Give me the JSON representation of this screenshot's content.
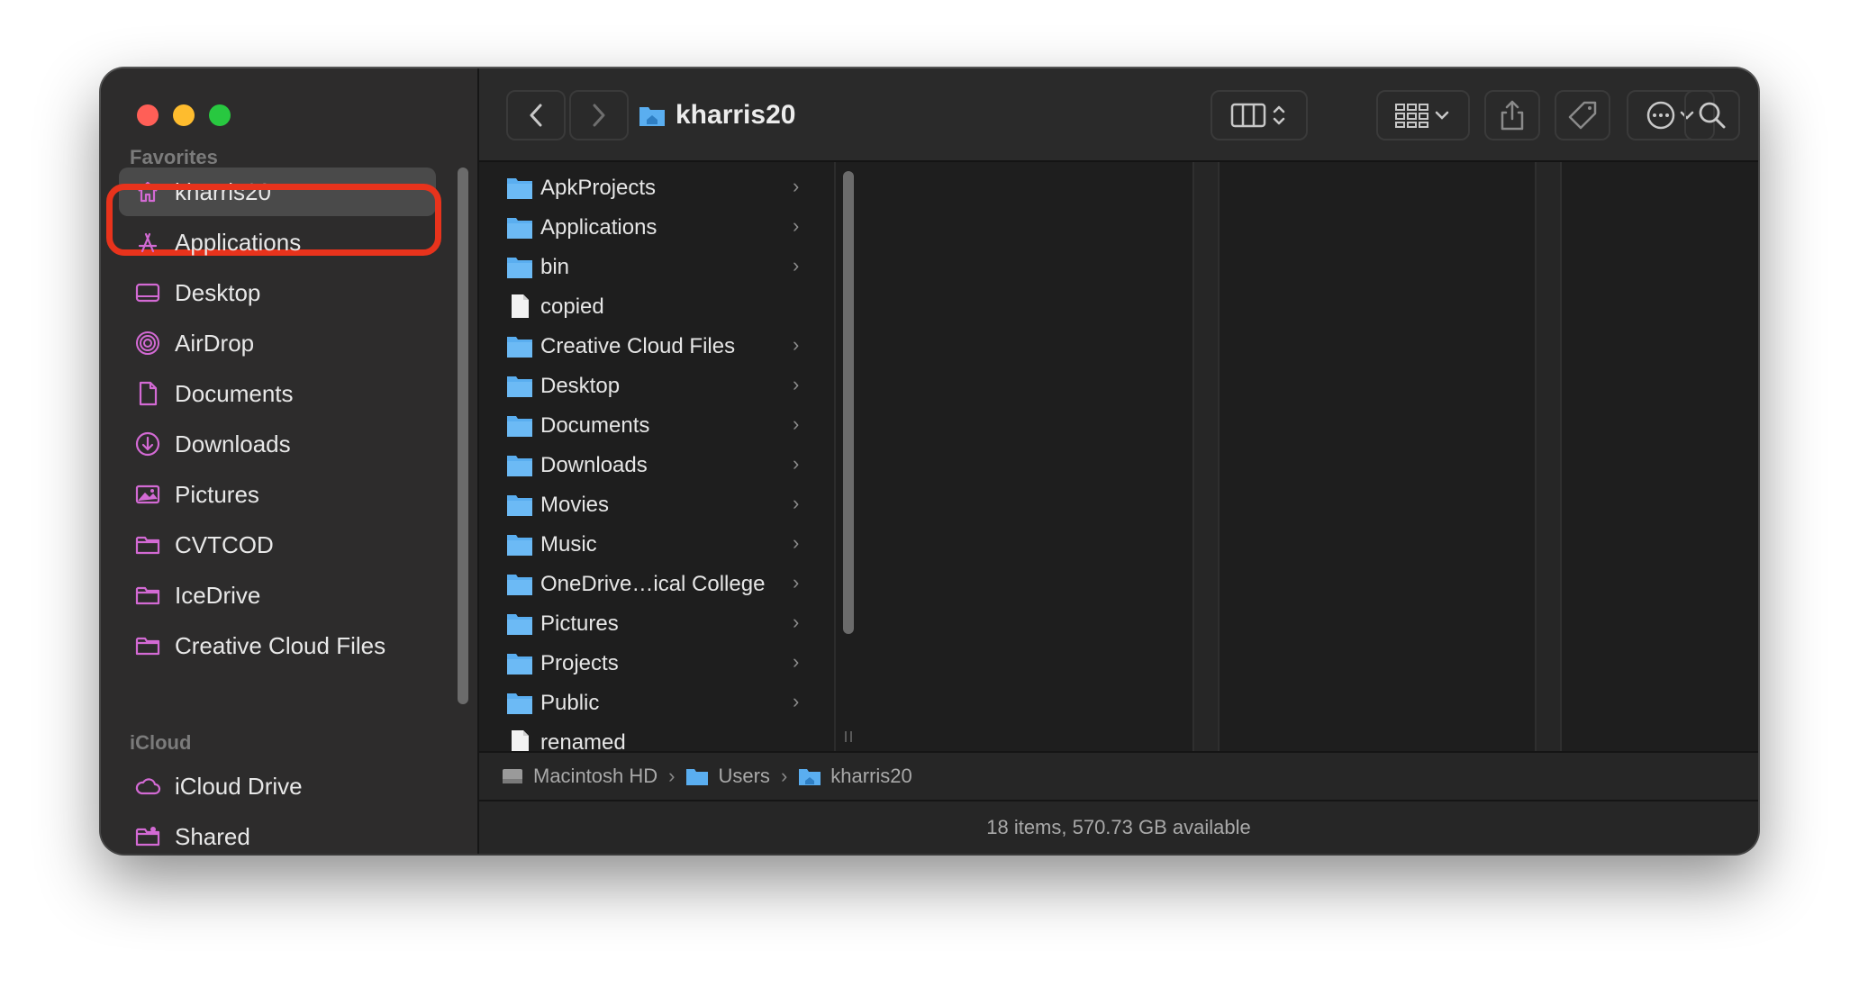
{
  "window": {
    "title": "kharris20"
  },
  "sidebar": {
    "favorites_label": "Favorites",
    "favorites": [
      {
        "label": "kharris20",
        "icon": "home-icon",
        "selected": true
      },
      {
        "label": "Applications",
        "icon": "applications-icon"
      },
      {
        "label": "Desktop",
        "icon": "desktop-icon"
      },
      {
        "label": "AirDrop",
        "icon": "airdrop-icon"
      },
      {
        "label": "Documents",
        "icon": "document-icon"
      },
      {
        "label": "Downloads",
        "icon": "download-icon"
      },
      {
        "label": "Pictures",
        "icon": "pictures-icon"
      },
      {
        "label": "CVTCOD",
        "icon": "folder-icon"
      },
      {
        "label": "IceDrive",
        "icon": "folder-icon"
      },
      {
        "label": "Creative Cloud Files",
        "icon": "folder-icon"
      }
    ],
    "icloud_label": "iCloud",
    "icloud": [
      {
        "label": "iCloud Drive",
        "icon": "cloud-icon"
      },
      {
        "label": "Shared",
        "icon": "shared-folder-icon"
      }
    ],
    "icon_color": "#d36ad4"
  },
  "files": [
    {
      "name": "ApkProjects",
      "type": "folder"
    },
    {
      "name": "Applications",
      "type": "folder"
    },
    {
      "name": "bin",
      "type": "folder"
    },
    {
      "name": "copied",
      "type": "file"
    },
    {
      "name": "Creative Cloud Files",
      "type": "folder"
    },
    {
      "name": "Desktop",
      "type": "folder"
    },
    {
      "name": "Documents",
      "type": "folder"
    },
    {
      "name": "Downloads",
      "type": "folder"
    },
    {
      "name": "Movies",
      "type": "folder"
    },
    {
      "name": "Music",
      "type": "folder"
    },
    {
      "name": "OneDrive…ical College",
      "type": "folder"
    },
    {
      "name": "Pictures",
      "type": "folder"
    },
    {
      "name": "Projects",
      "type": "folder"
    },
    {
      "name": "Public",
      "type": "folder"
    },
    {
      "name": "renamed",
      "type": "file"
    }
  ],
  "pathbar": {
    "segments": [
      "Macintosh HD",
      "Users",
      "kharris20"
    ],
    "separator": "›"
  },
  "status": {
    "text": "18 items, 570.73 GB available"
  },
  "colors": {
    "folder": "#5aaef0",
    "highlight": "#e8331c"
  }
}
